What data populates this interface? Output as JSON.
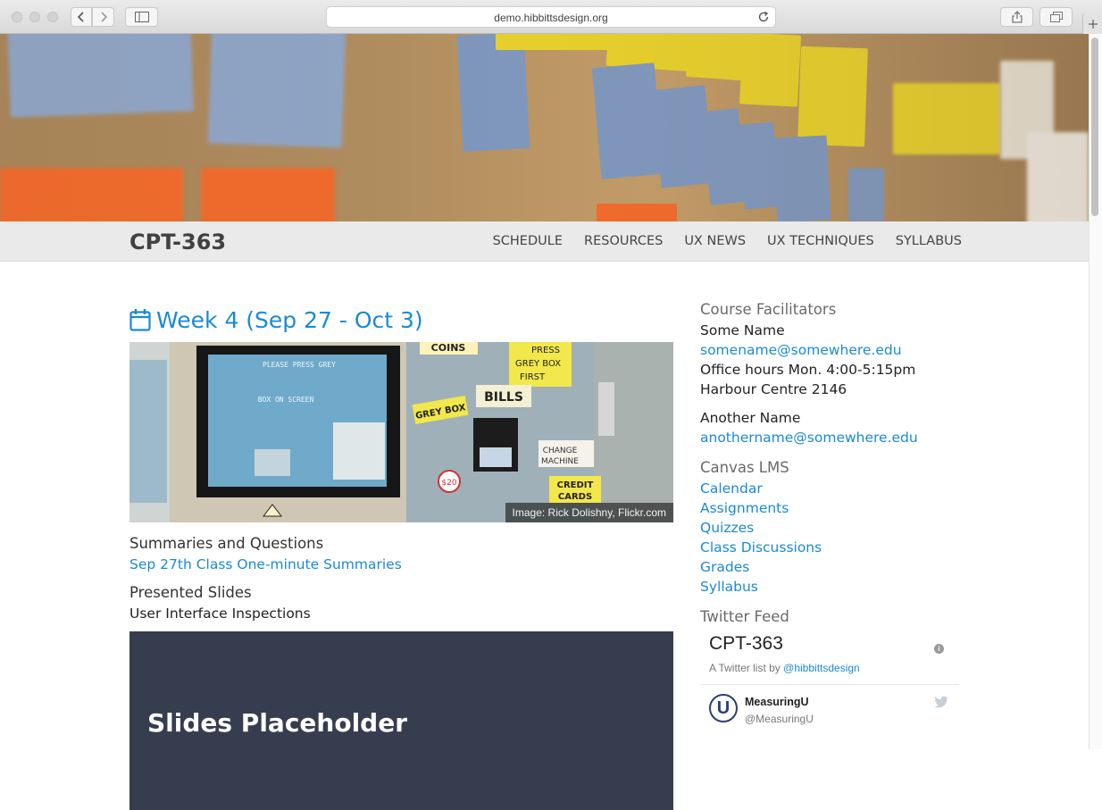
{
  "browser": {
    "url": "demo.hibbittsdesign.org"
  },
  "site": {
    "brand": "CPT-363",
    "nav": [
      "SCHEDULE",
      "RESOURCES",
      "UX NEWS",
      "UX TECHNIQUES",
      "SYLLABUS"
    ]
  },
  "main": {
    "week_title": "Week 4 (Sep 27 - Oct 3)",
    "photo_caption": "Image: Rick Dolishny, Flickr.com",
    "summaries_heading": "Summaries and Questions",
    "summaries_link": "Sep 27th Class One-minute Summaries",
    "slides_heading": "Presented Slides",
    "slides_name": "User Interface Inspections",
    "slides_placeholder": "Slides Placeholder"
  },
  "sidebar": {
    "facilitators_heading": "Course Facilitators",
    "facilitator1_name": "Some Name",
    "facilitator1_email": "somename@somewhere.edu",
    "facilitator1_hours": "Office hours Mon. 4:00-5:15pm",
    "facilitator1_room": "Harbour Centre 2146",
    "facilitator2_name": "Another Name",
    "facilitator2_email": "anothername@somewhere.edu",
    "canvas_heading": "Canvas LMS",
    "canvas_links": [
      "Calendar",
      "Assignments",
      "Quizzes",
      "Class Discussions",
      "Grades",
      "Syllabus"
    ],
    "twitter_heading": "Twitter Feed"
  },
  "twitter": {
    "list_title": "CPT-363",
    "list_by_prefix": "A Twitter list by",
    "list_by_handle": "@hibbittsdesign",
    "tweet_name": "MeasuringU",
    "tweet_handle": "@MeasuringU",
    "avatar_letter": "U"
  },
  "colors": {
    "link": "#1a8ad6",
    "nav_bg": "#eaeaea",
    "slides_bg": "#363d4f"
  }
}
